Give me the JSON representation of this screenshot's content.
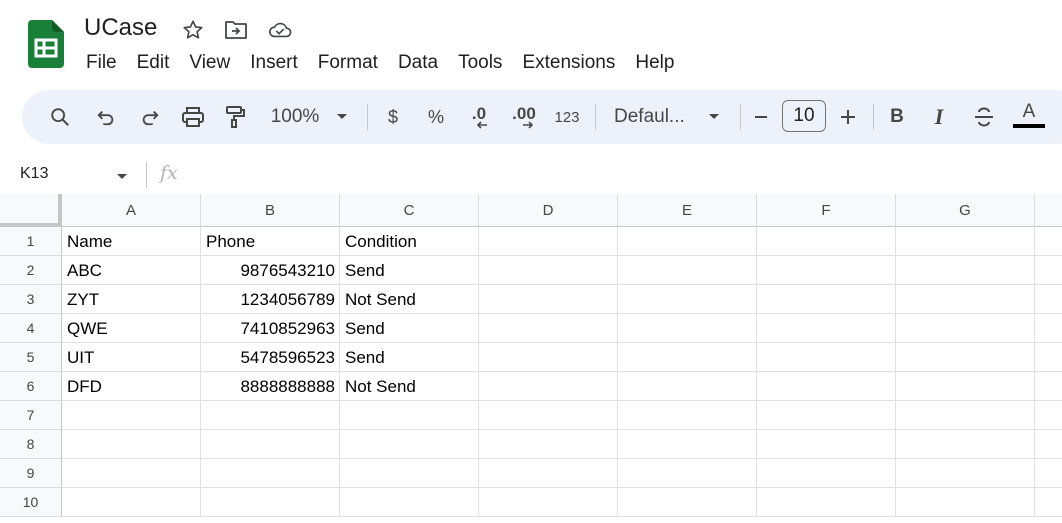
{
  "doc": {
    "title": "UCase",
    "icons": [
      "star-icon",
      "move-to-folder-icon",
      "cloud-saved-icon"
    ]
  },
  "menu": [
    "File",
    "Edit",
    "View",
    "Insert",
    "Format",
    "Data",
    "Tools",
    "Extensions",
    "Help"
  ],
  "toolbar": {
    "zoom": "100%",
    "currency": "$",
    "percent": "%",
    "decrease_decimal": ".0",
    "increase_decimal": ".00",
    "number_format": "123",
    "font": "Defaul...",
    "font_size": "10",
    "bold": "B",
    "italic": "I",
    "text_color": "A"
  },
  "formula_bar": {
    "cell_ref": "K13",
    "fx": "fx"
  },
  "sheet": {
    "columns": [
      "A",
      "B",
      "C",
      "D",
      "E",
      "F",
      "G"
    ],
    "rows": [
      "1",
      "2",
      "3",
      "4",
      "5",
      "6",
      "7",
      "8",
      "9",
      "10"
    ],
    "cells": [
      [
        "Name",
        "Phone",
        "Condition"
      ],
      [
        "ABC",
        "9876543210",
        "Send"
      ],
      [
        "ZYT",
        "1234056789",
        "Not Send"
      ],
      [
        "QWE",
        "7410852963",
        "Send"
      ],
      [
        "UIT",
        "5478596523",
        "Send"
      ],
      [
        "DFD",
        "8888888888",
        "Not Send"
      ],
      [
        "",
        "",
        ""
      ],
      [
        "",
        "",
        ""
      ],
      [
        "",
        "",
        ""
      ],
      [
        "",
        "",
        ""
      ]
    ]
  },
  "colors": {
    "sheets_green": "#188038",
    "toolbar_bg": "#edf2fa"
  }
}
